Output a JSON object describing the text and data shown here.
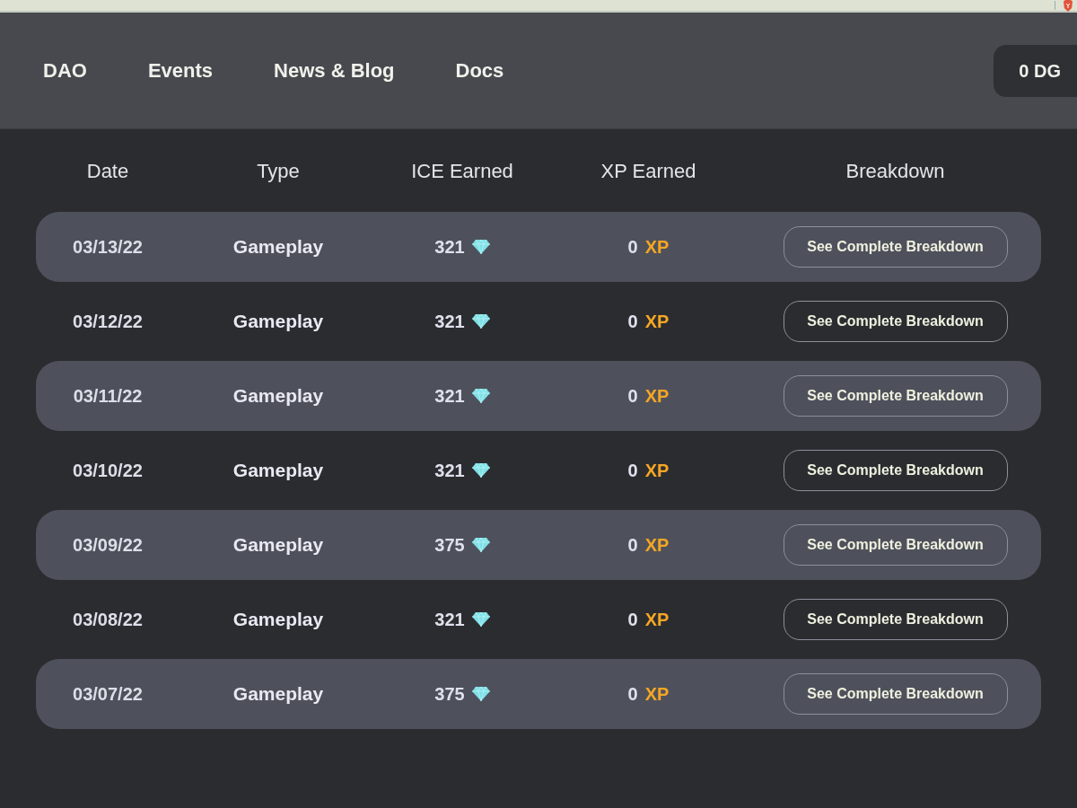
{
  "nav": {
    "links": [
      "DAO",
      "Events",
      "News & Blog",
      "Docs"
    ],
    "balance": "0 DG"
  },
  "table": {
    "columns": [
      "Date",
      "Type",
      "ICE Earned",
      "XP Earned",
      "Breakdown"
    ],
    "rows": [
      {
        "date": "03/13/22",
        "type": "Gameplay",
        "ice": "321",
        "xp": "0",
        "xp_unit": "XP",
        "action": "See Complete Breakdown"
      },
      {
        "date": "03/12/22",
        "type": "Gameplay",
        "ice": "321",
        "xp": "0",
        "xp_unit": "XP",
        "action": "See Complete Breakdown"
      },
      {
        "date": "03/11/22",
        "type": "Gameplay",
        "ice": "321",
        "xp": "0",
        "xp_unit": "XP",
        "action": "See Complete Breakdown"
      },
      {
        "date": "03/10/22",
        "type": "Gameplay",
        "ice": "321",
        "xp": "0",
        "xp_unit": "XP",
        "action": "See Complete Breakdown"
      },
      {
        "date": "03/09/22",
        "type": "Gameplay",
        "ice": "375",
        "xp": "0",
        "xp_unit": "XP",
        "action": "See Complete Breakdown"
      },
      {
        "date": "03/08/22",
        "type": "Gameplay",
        "ice": "321",
        "xp": "0",
        "xp_unit": "XP",
        "action": "See Complete Breakdown"
      },
      {
        "date": "03/07/22",
        "type": "Gameplay",
        "ice": "375",
        "xp": "0",
        "xp_unit": "XP",
        "action": "See Complete Breakdown"
      }
    ]
  }
}
